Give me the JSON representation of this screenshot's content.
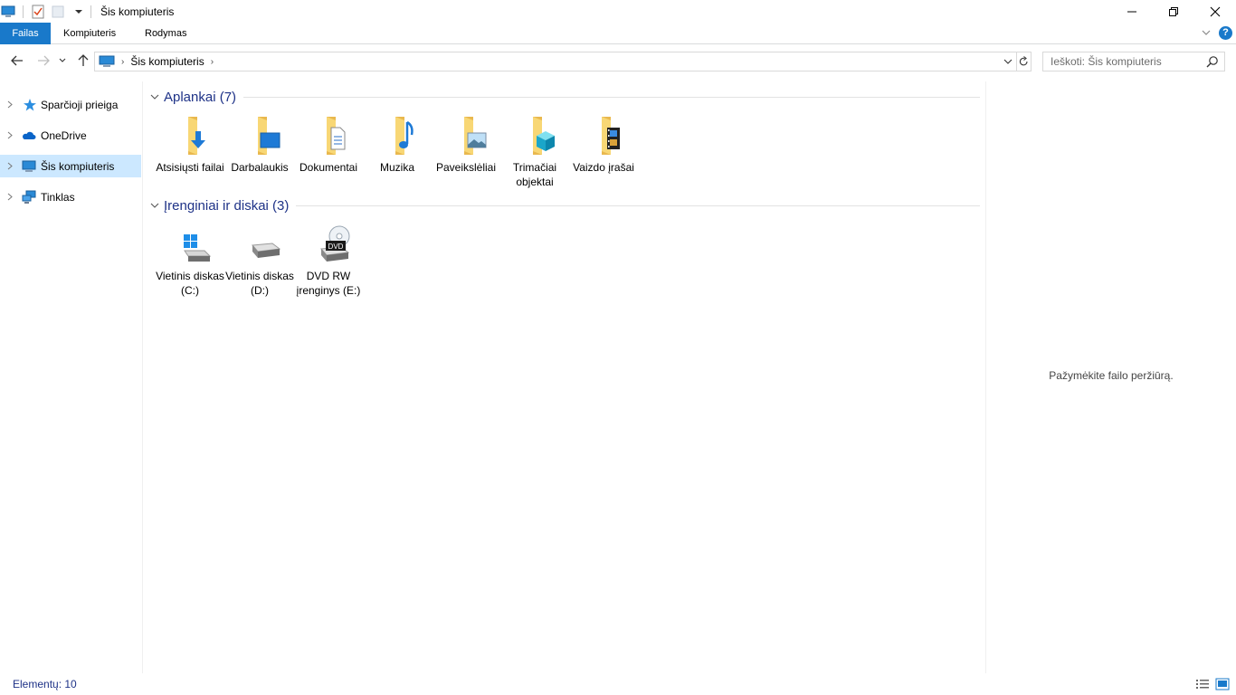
{
  "window": {
    "title": "Šis kompiuteris"
  },
  "ribbon": {
    "tabs": [
      {
        "label": "Failas"
      },
      {
        "label": "Kompiuteris"
      },
      {
        "label": "Rodymas"
      }
    ],
    "help_label": "?"
  },
  "address": {
    "crumb": "Šis kompiuteris",
    "search_placeholder": "Ieškoti: Šis kompiuteris"
  },
  "nav_pane": {
    "items": [
      {
        "label": "Sparčioji prieiga",
        "icon": "star-icon"
      },
      {
        "label": "OneDrive",
        "icon": "cloud-icon"
      },
      {
        "label": "Šis kompiuteris",
        "icon": "computer-icon",
        "selected": true
      },
      {
        "label": "Tinklas",
        "icon": "network-icon"
      }
    ]
  },
  "folders_group": {
    "title": "Aplankai (7)",
    "items": [
      {
        "label": "Atsisiųsti failai",
        "icon": "downloads-folder-icon"
      },
      {
        "label": "Darbalaukis",
        "icon": "desktop-folder-icon"
      },
      {
        "label": "Dokumentai",
        "icon": "documents-folder-icon"
      },
      {
        "label": "Muzika",
        "icon": "music-folder-icon"
      },
      {
        "label": "Paveikslėliai",
        "icon": "pictures-folder-icon"
      },
      {
        "label": "Trimačiai objektai",
        "icon": "3d-objects-folder-icon"
      },
      {
        "label": "Vaizdo įrašai",
        "icon": "videos-folder-icon"
      }
    ]
  },
  "drives_group": {
    "title": "Įrenginiai ir diskai (3)",
    "items": [
      {
        "label": "Vietinis diskas (C:)",
        "icon": "windows-drive-icon"
      },
      {
        "label": "Vietinis diskas (D:)",
        "icon": "hard-drive-icon"
      },
      {
        "label": "DVD RW įrenginys (E:)",
        "icon": "dvd-drive-icon",
        "badge": "DVD"
      }
    ]
  },
  "preview": {
    "text": "Pažymėkite failo peržiūrą."
  },
  "status": {
    "count": "Elementų: 10"
  },
  "colors": {
    "accent": "#1979ca",
    "selection": "#cce8ff",
    "group_title": "#1e3287"
  }
}
